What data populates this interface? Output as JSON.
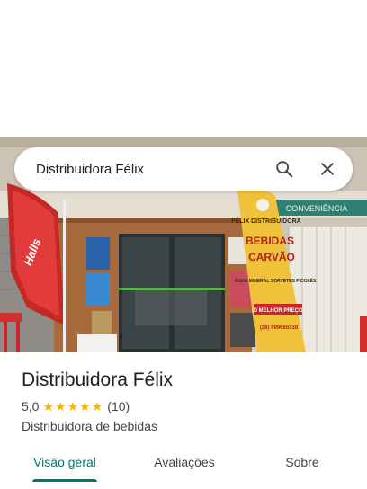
{
  "search": {
    "query": "Distribuidora Félix"
  },
  "place": {
    "name": "Distribuidora Félix",
    "rating": "5,0",
    "review_count": "(10)",
    "category": "Distribuidora de bebidas"
  },
  "photo_signage": {
    "banner_left": "Halls",
    "banner_right_title": "FÉLIX DISTRIBUIDORA",
    "banner_right_line1": "BEBIDAS",
    "banner_right_line2": "CARVÃO",
    "banner_right_line3": "ÁGUA MINERAL SORVETES PICOLÉS",
    "banner_right_line4": "O MELHOR PREÇO",
    "banner_right_phone": "(28) 999685538",
    "store_sign": "CONVENIÊNCIA"
  },
  "tabs": [
    {
      "label": "Visão geral",
      "active": true
    },
    {
      "label": "Avaliações",
      "active": false
    },
    {
      "label": "Sobre",
      "active": false
    }
  ],
  "colors": {
    "accent": "#00796b",
    "star": "#f4b400"
  }
}
